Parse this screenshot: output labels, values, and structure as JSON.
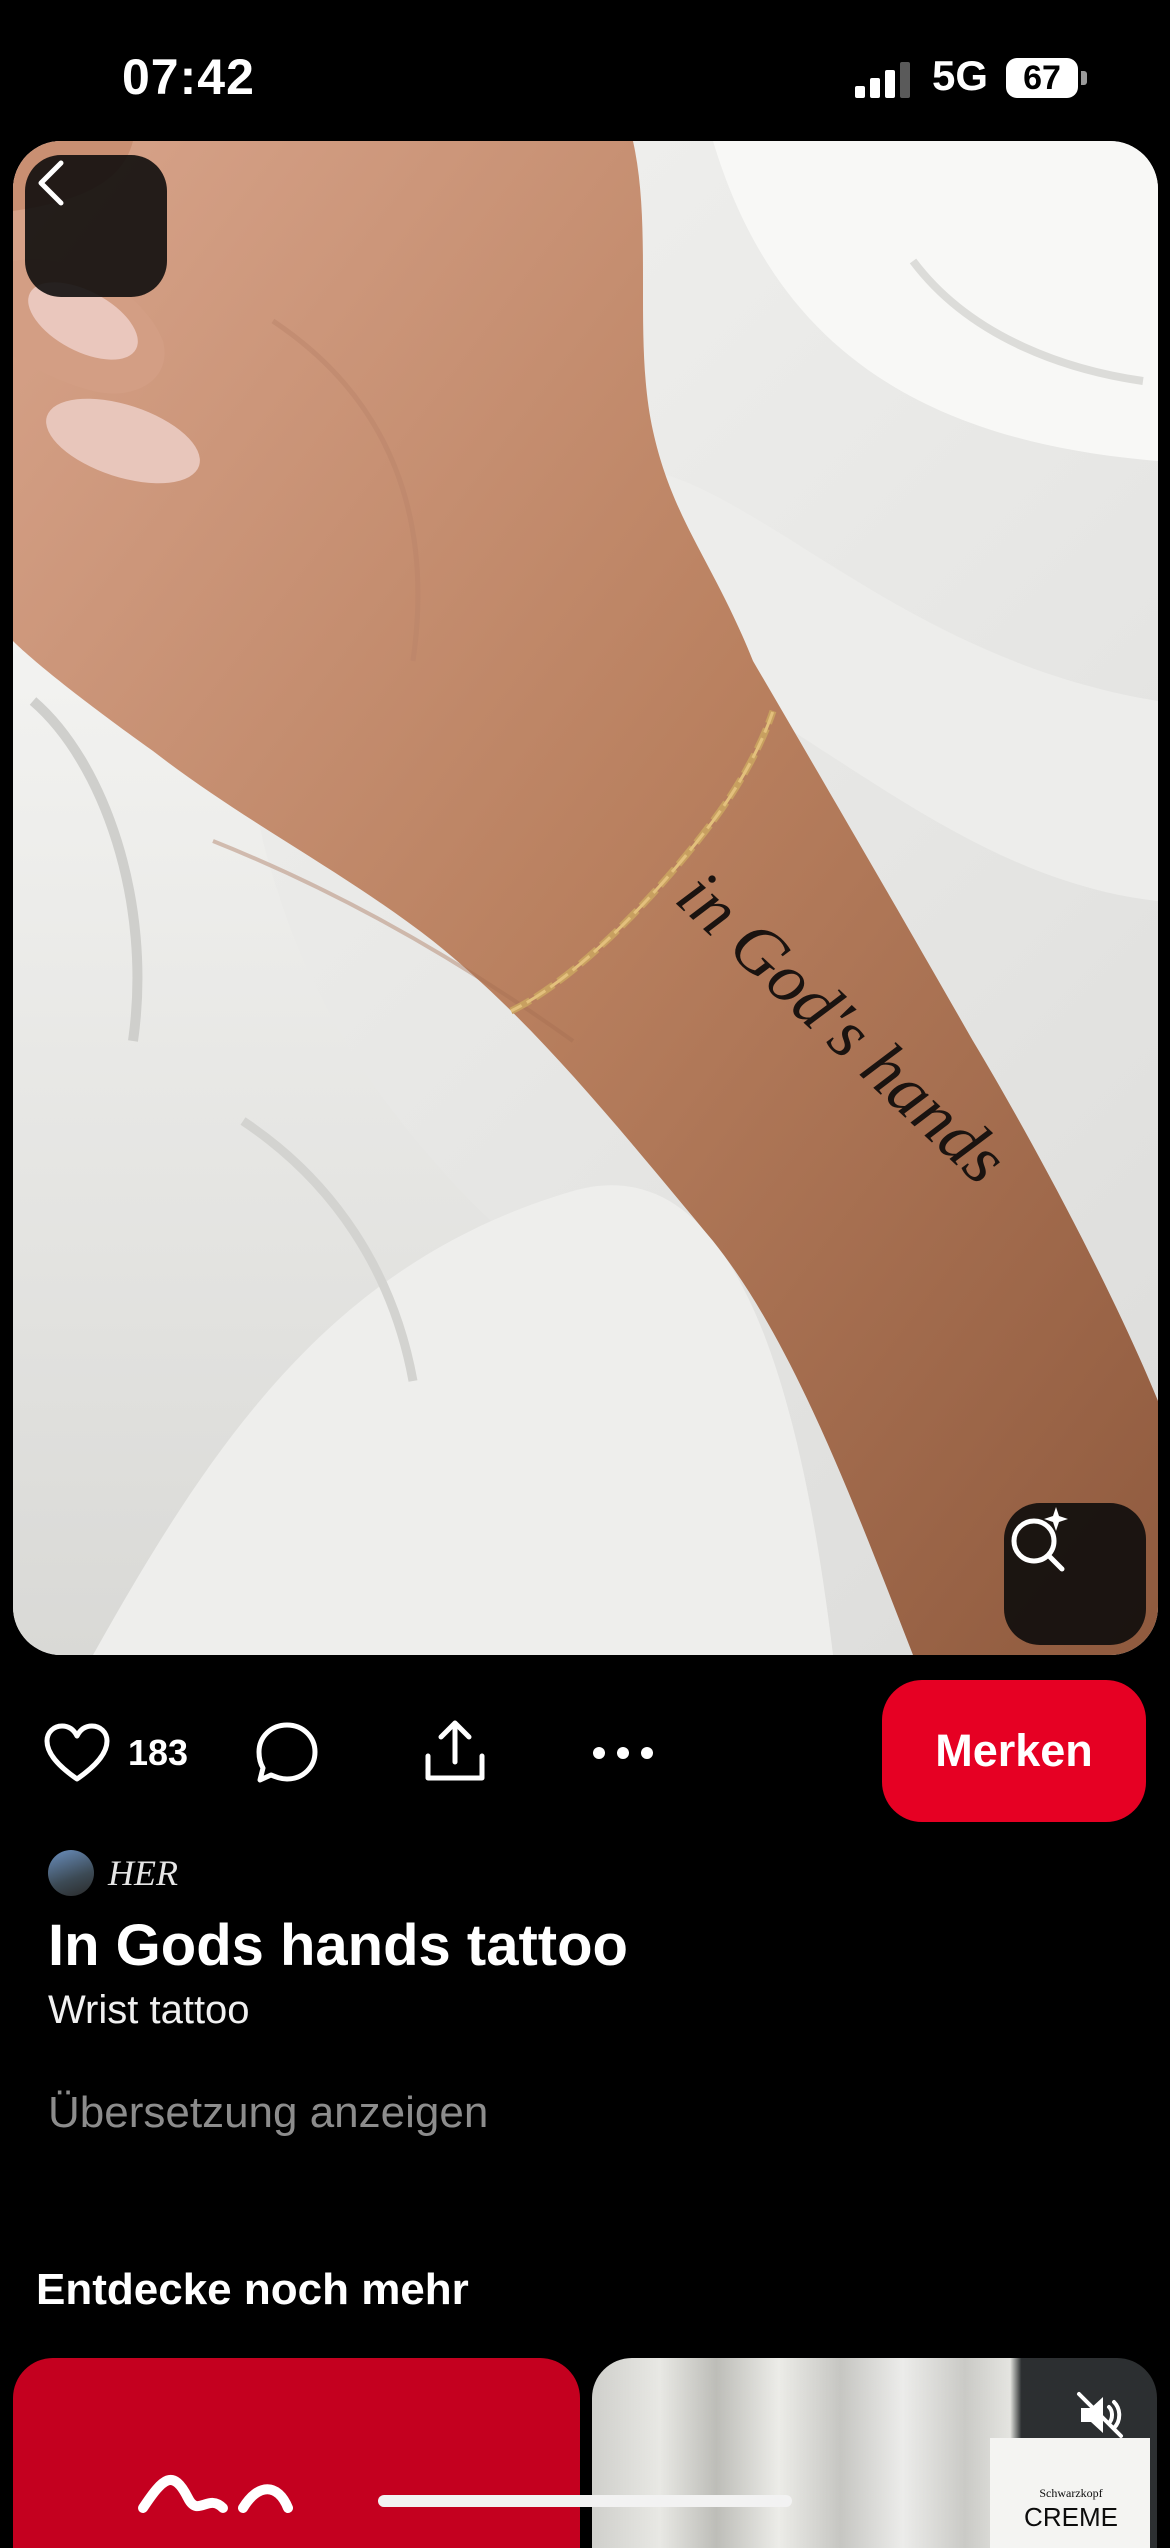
{
  "status_bar": {
    "time": "07:42",
    "network": "5G",
    "battery": "67"
  },
  "pin": {
    "likes": "183",
    "save_label": "Merken",
    "author": "HER",
    "title": "In Gods hands tattoo",
    "description": "Wrist tattoo",
    "translate_label": "Übersetzung anzeigen",
    "tattoo_text": "in God's hands"
  },
  "discover": {
    "heading": "Entdecke noch mehr",
    "card2_brand": "Schwarzkopf",
    "card2_product": "CREME"
  },
  "colors": {
    "accent": "#e60023",
    "background": "#000000"
  },
  "icons": {
    "back": "chevron-left-icon",
    "lens": "visual-search-icon",
    "like": "heart-icon",
    "comment": "comment-icon",
    "share": "share-icon",
    "more": "ellipsis-icon",
    "mute": "muted-speaker-icon"
  }
}
